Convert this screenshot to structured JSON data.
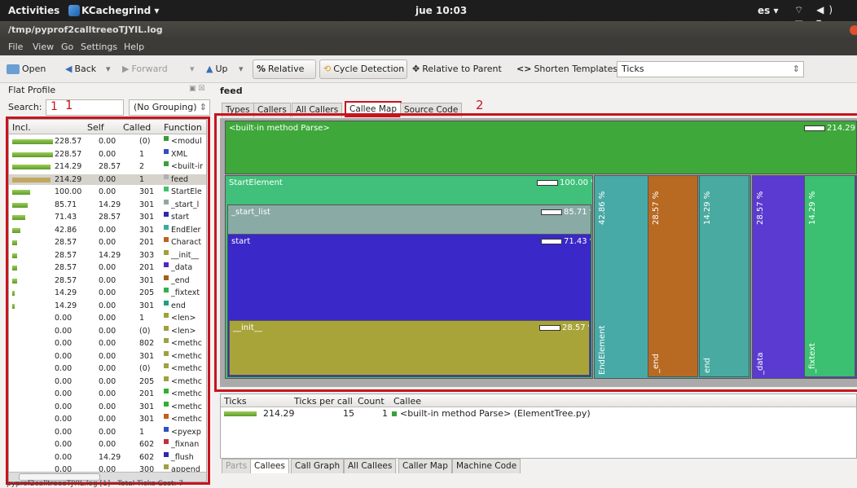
{
  "topbar": {
    "activities": "Activities",
    "app": "KCachegrind ▾",
    "clock": "jue 10:03",
    "lang": "es ▾",
    "sys": "⌔ ◀) ▬ ▾"
  },
  "window": {
    "title": "/tmp/pyprof2calltreeoTJYIL.log"
  },
  "menu": [
    "File",
    "View",
    "Go",
    "Settings",
    "Help"
  ],
  "toolbar": {
    "open": "Open",
    "back": "Back",
    "forward": "Forward",
    "up": "Up",
    "relative": "Relative",
    "cycle": "Cycle Detection",
    "relative_parent": "Relative to Parent",
    "shorten": "Shorten Templates",
    "ticks": "Ticks"
  },
  "flat_profile": {
    "title": "Flat Profile",
    "search_label": "Search:",
    "search_value": "1",
    "grouping": "(No Grouping)",
    "columns": [
      "Incl.",
      "Self",
      "Called",
      "Function"
    ],
    "rows": [
      {
        "incl": "228.57",
        "self": "0.00",
        "called": "(0)",
        "func": "<modul",
        "bar": 1.0,
        "color": "#3a9a3a"
      },
      {
        "incl": "228.57",
        "self": "0.00",
        "called": "1",
        "func": "XML",
        "bar": 1.0,
        "color": "#3050c0"
      },
      {
        "incl": "214.29",
        "self": "28.57",
        "called": "2",
        "func": "<built-ir",
        "bar": 0.94,
        "color": "#3aa03a"
      },
      {
        "incl": "214.29",
        "self": "0.00",
        "called": "1",
        "func": "feed",
        "bar": 0.94,
        "color": "#b0b0b0"
      },
      {
        "incl": "100.00",
        "self": "0.00",
        "called": "301",
        "func": "StartEle",
        "bar": 0.44,
        "color": "#40c070"
      },
      {
        "incl": "85.71",
        "self": "14.29",
        "called": "301",
        "func": "_start_l",
        "bar": 0.37,
        "color": "#90a8a0"
      },
      {
        "incl": "71.43",
        "self": "28.57",
        "called": "301",
        "func": "start",
        "bar": 0.31,
        "color": "#3028b0"
      },
      {
        "incl": "42.86",
        "self": "0.00",
        "called": "301",
        "func": "EndEler",
        "bar": 0.19,
        "color": "#40a8a0"
      },
      {
        "incl": "28.57",
        "self": "0.00",
        "called": "201",
        "func": "Charact",
        "bar": 0.12,
        "color": "#c06020"
      },
      {
        "incl": "28.57",
        "self": "14.29",
        "called": "303",
        "func": "__init__",
        "bar": 0.12,
        "color": "#a0a040"
      },
      {
        "incl": "28.57",
        "self": "0.00",
        "called": "201",
        "func": "_data",
        "bar": 0.12,
        "color": "#5028c0"
      },
      {
        "incl": "28.57",
        "self": "0.00",
        "called": "301",
        "func": "_end",
        "bar": 0.12,
        "color": "#a06020"
      },
      {
        "incl": "14.29",
        "self": "0.00",
        "called": "205",
        "func": "_fixtext",
        "bar": 0.06,
        "color": "#30b050"
      },
      {
        "incl": "14.29",
        "self": "0.00",
        "called": "301",
        "func": "end",
        "bar": 0.06,
        "color": "#20a080"
      },
      {
        "incl": "0.00",
        "self": "0.00",
        "called": "1",
        "func": "<len>",
        "bar": 0,
        "color": "#a0a040"
      },
      {
        "incl": "0.00",
        "self": "0.00",
        "called": "(0)",
        "func": "<len>",
        "bar": 0,
        "color": "#a0a040"
      },
      {
        "incl": "0.00",
        "self": "0.00",
        "called": "802",
        "func": "<methc",
        "bar": 0,
        "color": "#a0a040"
      },
      {
        "incl": "0.00",
        "self": "0.00",
        "called": "301",
        "func": "<methc",
        "bar": 0,
        "color": "#a0a040"
      },
      {
        "incl": "0.00",
        "self": "0.00",
        "called": "(0)",
        "func": "<methc",
        "bar": 0,
        "color": "#a0a040"
      },
      {
        "incl": "0.00",
        "self": "0.00",
        "called": "205",
        "func": "<methc",
        "bar": 0,
        "color": "#a0a040"
      },
      {
        "incl": "0.00",
        "self": "0.00",
        "called": "201",
        "func": "<methc",
        "bar": 0,
        "color": "#30b030"
      },
      {
        "incl": "0.00",
        "self": "0.00",
        "called": "301",
        "func": "<methc",
        "bar": 0,
        "color": "#30b030"
      },
      {
        "incl": "0.00",
        "self": "0.00",
        "called": "301",
        "func": "<methc",
        "bar": 0,
        "color": "#c06020"
      },
      {
        "incl": "0.00",
        "self": "0.00",
        "called": "1",
        "func": "<pyexp",
        "bar": 0,
        "color": "#3050c0"
      },
      {
        "incl": "0.00",
        "self": "0.00",
        "called": "602",
        "func": "_fixnan",
        "bar": 0,
        "color": "#c03040"
      },
      {
        "incl": "0.00",
        "self": "14.29",
        "called": "602",
        "func": "_flush",
        "bar": 0,
        "color": "#3028b0"
      },
      {
        "incl": "0.00",
        "self": "0.00",
        "called": "300",
        "func": "append",
        "bar": 0,
        "color": "#a0a040"
      }
    ]
  },
  "annotations": {
    "one": "1",
    "two": "2"
  },
  "feed_label": "feed",
  "tabs_top": [
    "Types",
    "Callers",
    "All Callers",
    "Callee Map",
    "Source Code"
  ],
  "treemap": {
    "root": {
      "name": "<built-in method Parse>",
      "pct": "214.29 %"
    },
    "start_element": {
      "name": "StartElement",
      "pct": "100.00 %"
    },
    "start_list": {
      "name": "_start_list",
      "pct": "85.71 %"
    },
    "start": {
      "name": "start",
      "pct": "71.43 %"
    },
    "init": {
      "name": "__init__",
      "pct": "28.57 %"
    },
    "end_element": {
      "name": "EndElement",
      "pct": "42.86 %"
    },
    "end_u": {
      "name": "_end",
      "pct": "28.57 %"
    },
    "end": {
      "name": "end",
      "pct": "14.29 %"
    },
    "data": {
      "name": "_data",
      "pct": "28.57 %"
    },
    "fixtext": {
      "name": "_fixtext",
      "pct": "14.29 %"
    }
  },
  "callees": {
    "columns": [
      "Ticks",
      "Ticks per call",
      "Count",
      "Callee"
    ],
    "row": {
      "ticks": "214.29",
      "per_call": "15",
      "count": "1",
      "callee": "<built-in method Parse> (ElementTree.py)"
    }
  },
  "tabs_bottom": [
    "Parts",
    "Callees",
    "Call Graph",
    "All Callees",
    "Caller Map",
    "Machine Code"
  ],
  "status": "pyprof2calltreeoTJYIL.log [1] - Total Ticks Cost: 7"
}
